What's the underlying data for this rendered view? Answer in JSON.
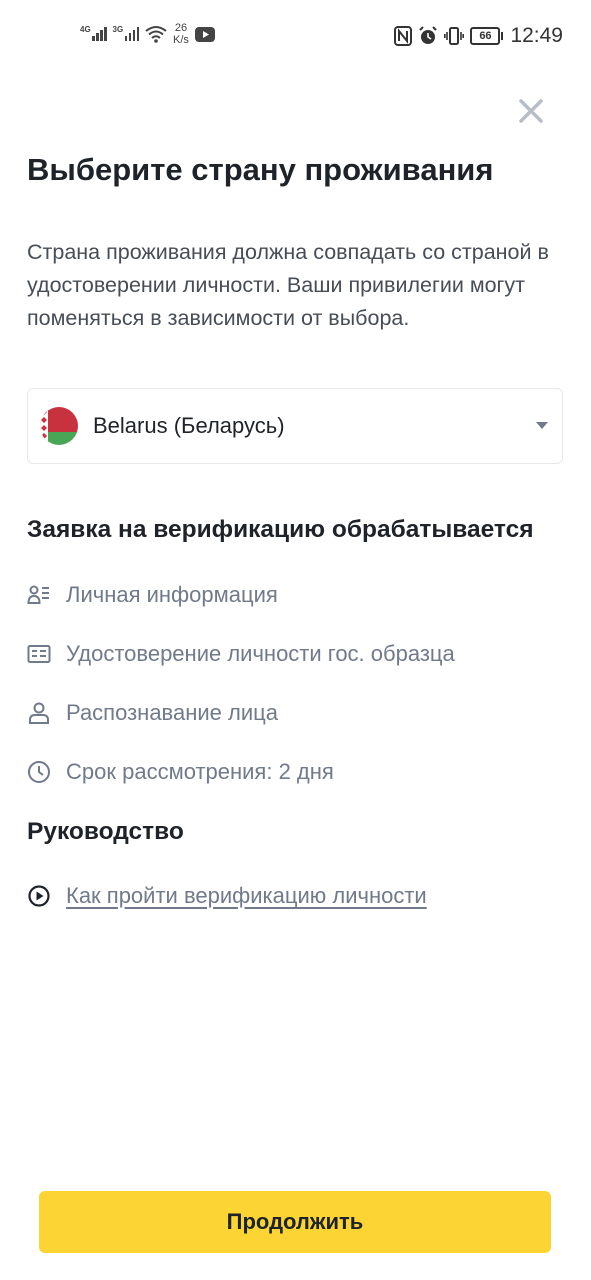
{
  "status_bar": {
    "network_1": "4G",
    "network_2": "3G",
    "speed_value": "26",
    "speed_unit": "K/s",
    "battery": "66",
    "time": "12:49",
    "icons": [
      "signal-icon",
      "wifi-icon",
      "youtube-icon",
      "nfc-icon",
      "alarm-icon",
      "vibrate-icon",
      "battery-icon"
    ]
  },
  "header": {
    "close_icon": "close-icon",
    "title": "Выберите страну проживания"
  },
  "description": "Страна проживания должна совпадать со страной в удостоверении личности. Ваши привилегии могут поменяться в зависимости от выбора.",
  "country_select": {
    "value": "Belarus (Беларусь)",
    "flag_icon": "belarus-flag-icon",
    "caret_icon": "caret-down-icon"
  },
  "verification": {
    "heading": "Заявка на верификацию обрабатывается",
    "items": [
      {
        "icon": "personal-info-icon",
        "label": "Личная информация"
      },
      {
        "icon": "id-card-icon",
        "label": "Удостоверение личности гос. образца"
      },
      {
        "icon": "face-icon",
        "label": "Распознавание лица"
      },
      {
        "icon": "clock-icon",
        "label": "Срок рассмотрения: 2 дня"
      }
    ]
  },
  "guide": {
    "heading": "Руководство",
    "link_icon": "play-circle-icon",
    "link_label": "Как пройти верификацию личности"
  },
  "footer": {
    "continue_label": "Продолжить"
  },
  "colors": {
    "accent": "#fcd535",
    "text_primary": "#1e2329",
    "text_secondary": "#707a8a",
    "border": "#e6e8ea"
  }
}
